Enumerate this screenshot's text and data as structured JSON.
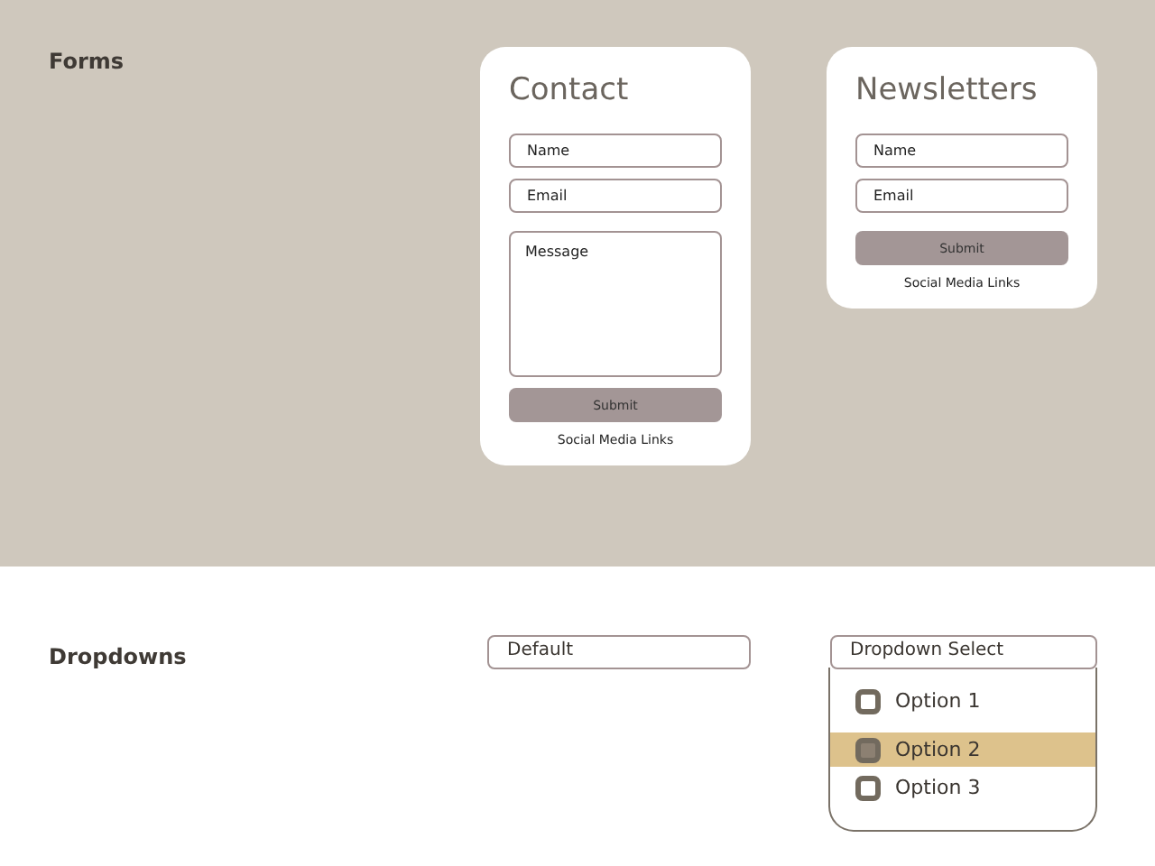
{
  "forms": {
    "heading": "Forms",
    "cards": [
      {
        "title": "Contact",
        "fields": [
          {
            "kind": "input",
            "placeholder": "Name"
          },
          {
            "kind": "input",
            "placeholder": "Email"
          },
          {
            "kind": "textarea",
            "placeholder": "Message"
          }
        ],
        "button": "Submit",
        "links": "Social Media Links"
      },
      {
        "title": "Newsletters",
        "fields": [
          {
            "kind": "input",
            "placeholder": "Name"
          },
          {
            "kind": "input",
            "placeholder": "Email"
          }
        ],
        "button": "Submit",
        "links": "Social Media Links"
      }
    ]
  },
  "dropdowns": {
    "heading": "Dropdowns",
    "default_select": {
      "value": "Default"
    },
    "open_select": {
      "value": "Dropdown Select",
      "options": [
        {
          "label": "Option 1",
          "selected": false
        },
        {
          "label": "Option 2",
          "selected": true
        },
        {
          "label": "Option 3",
          "selected": false
        }
      ]
    }
  }
}
